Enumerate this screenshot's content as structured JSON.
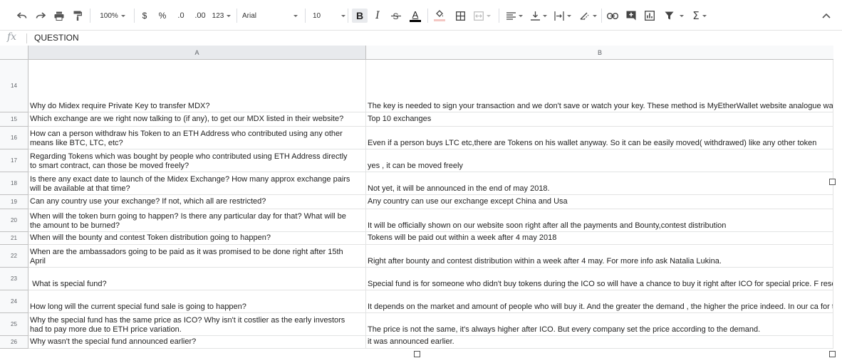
{
  "toolbar": {
    "zoom": "100%",
    "currency": "$",
    "percent": "%",
    "decrease_decimal": ".0",
    "increase_decimal": ".00",
    "more_formats": "123",
    "font": "Arial",
    "font_size": "10",
    "bold": "B",
    "italic": "I",
    "text_color": "A"
  },
  "formula_bar": {
    "fx": "fx",
    "value": "QUESTION"
  },
  "columns": [
    "A",
    "B"
  ],
  "rows": [
    {
      "num": "14",
      "a": "Why do Midex require Private Key to transfer MDX?",
      "b": "The key is needed to sign your transaction and we don't save or watch your key. These method is MyEtherWallet website analogue\nway: There is a cryptocurrency node for Etherium. So the node is the distribution programm packages which are provided by ETH\nincluding Midex refers to that node by API to transfer transaction which afterwards sends to blockchain. On the moment of sending\nwebsite to the node it is necessary to sign up the transaction by your private key. Transaction is signed and send. During this proce\nsending anywhere and the transaction is sending already encrypted."
    },
    {
      "num": "15",
      "a": "Which exchange are we right now talking to (if any), to get our MDX listed in their website?",
      "b": "Top 10 exchanges"
    },
    {
      "num": "16",
      "a": "How can a person withdraw his Token to an ETH Address who contributed using any other\nmeans like BTC, LTC, etc?",
      "b": "Even if a person buys LTC etc,there are Tokens on his wallet anyway. So it can be easily moved( withdrawed)  like any other token"
    },
    {
      "num": "17",
      "a": "Regarding Tokens which was bought by people who contributed using ETH Address directly\nto smart contract, can those be moved freely?",
      "b": "yes , it can be moved freely"
    },
    {
      "num": "18",
      "a": "Is there any exact date to launch of the Midex Exchange? How many approx exchange pairs\nwill be available at that time?",
      "b": "Not yet, it will be announced in the end  of may 2018."
    },
    {
      "num": "19",
      "a": "Can any country use your exchange? If not, which all are restricted?",
      "b": "Any country can use our exchange except China and Usa"
    },
    {
      "num": "20",
      "a": "When will the token burn going to happen? Is there any particular day for that? What will be\nthe amount to be burned?",
      "b": "It will be officially shown on our website soon right after all the payments and Bounty,contest distribution"
    },
    {
      "num": "21",
      "a": "When will the bounty and contest Token distribution going to happen?",
      "b": "Tokens will be paid out within a week after 4 may 2018"
    },
    {
      "num": "22",
      "a": "When are the ambassadors going to be paid as it was promised to be done right after 15th\nApril",
      "b": "Right after  bounty and contest distribution within a week after 4 may. For more info ask Natalia Lukina."
    },
    {
      "num": "23",
      "a": " What is special fund?",
      "b": "Special fund is for someone who didn't buy tokens during the ICO so will have a chance to buy it right after ICO for special price. F\nreserve some and sell it for a bit higher price. In our case the price stayes the same at this moment, it will get higher right after exc"
    },
    {
      "num": "24",
      "a": "How long will the current special fund sale is going to happen?",
      "b": " It depends on the market and amount of people who will buy it. And the greater the demand , the higher the price indeed. In our ca\nfor the moment. bacause we planed to sell much more than we did. So the mdx price stayes the same $1.2"
    },
    {
      "num": "25",
      "a": "Why the special fund has the same price as ICO? Why isn't it costlier as the early investors\nhad to pay more due to ETH price variation.",
      "b": "The price is not the same, it's always higher after ICO. But every company set the price according to the demand."
    },
    {
      "num": "26",
      "a": "Why wasn't the special fund announced earlier?",
      "b": "it was announced earlier."
    }
  ]
}
